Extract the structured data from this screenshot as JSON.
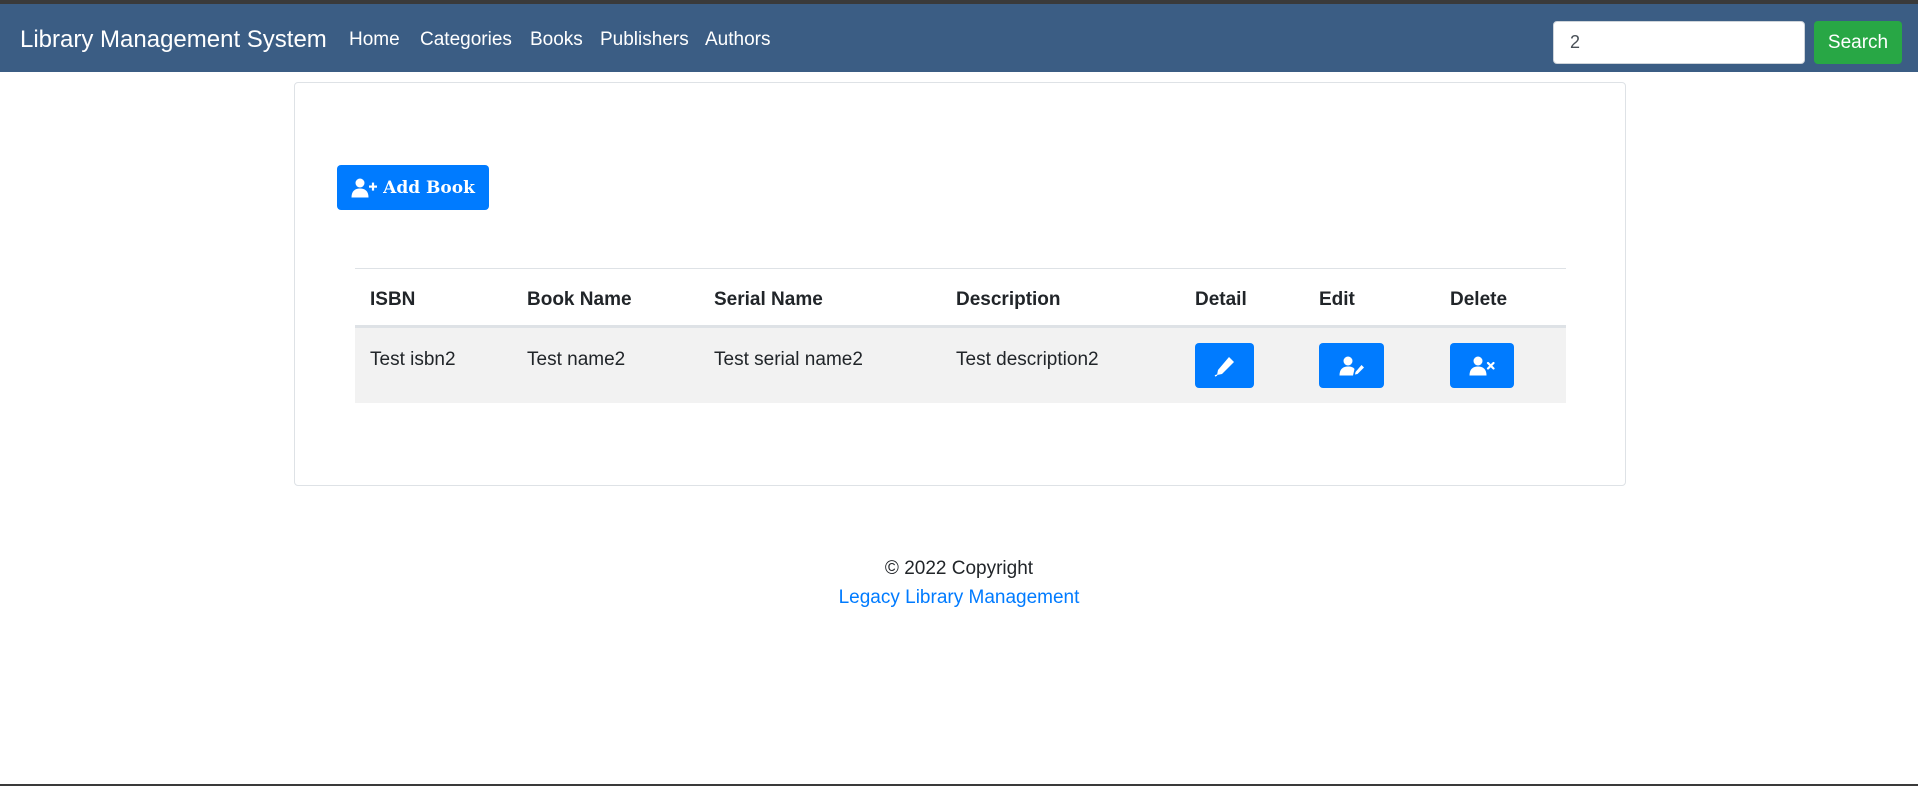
{
  "navbar": {
    "brand": "Library Management System",
    "links": [
      "Home",
      "Categories",
      "Books",
      "Publishers",
      "Authors"
    ],
    "search": {
      "value": "2",
      "button_label": "Search"
    }
  },
  "main": {
    "add_button_label": "Add Book",
    "table": {
      "headers": [
        "ISBN",
        "Book Name",
        "Serial Name",
        "Description",
        "Detail",
        "Edit",
        "Delete"
      ],
      "rows": [
        {
          "isbn": "Test isbn2",
          "book_name": "Test name2",
          "serial_name": "Test serial name2",
          "description": "Test description2"
        }
      ]
    }
  },
  "footer": {
    "copyright": "© 2022 Copyright",
    "link": "Legacy Library Management"
  },
  "colors": {
    "navbar": "#3b5d84",
    "primary": "#007bff",
    "success": "#28a745",
    "row_stripe": "#f2f2f2"
  },
  "icons": {
    "add": "user-plus-icon",
    "detail": "pen-icon",
    "edit": "user-edit-icon",
    "delete": "user-times-icon"
  }
}
